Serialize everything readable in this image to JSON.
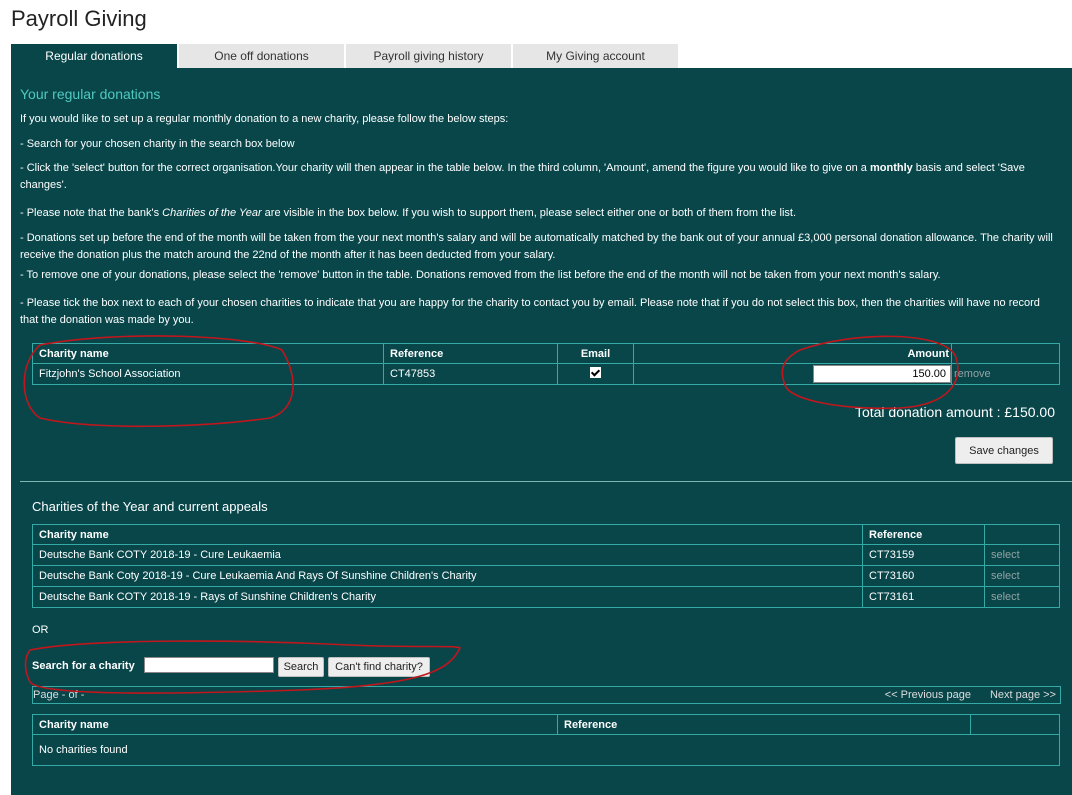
{
  "page": {
    "title": "Payroll Giving"
  },
  "tabs": [
    {
      "label": "Regular donations"
    },
    {
      "label": "One off donations"
    },
    {
      "label": "Payroll giving history"
    },
    {
      "label": "My Giving account"
    }
  ],
  "regular": {
    "heading": "Your regular donations",
    "intro": "If you would like to set up a regular monthly donation to a new charity, please follow the below steps:",
    "steps": {
      "s1": "- Search for your chosen charity in the search box below",
      "s2_pre": "- Click the 'select' button for the correct organisation.Your charity will then appear in the table below. In the third column, 'Amount', amend the figure you would like to give on a ",
      "s2_bold": "monthly",
      "s2_post": " basis and select 'Save changes'.",
      "s3_pre": "- Please note that the bank's ",
      "s3_ital": "Charities of the Year",
      "s3_post": " are visible in the box below. If you wish to support them, please select either one or both of them from the list.",
      "s4": "- Donations set up before the end of the month will be taken from the your next month's salary and will be automatically matched by the bank out of your annual £3,000 personal donation allowance. The charity will receive the donation plus the match around the 22nd of the month after it has been deducted from your salary.",
      "s5": "- To remove one of your donations, please select the 'remove' button in the table. Donations removed from the list before the end of the month will not be taken from your next month's salary.",
      "s6": "- Please tick the box next to each of your chosen charities to indicate that you are happy for the charity to contact you by email. Please note that if you do not select this box, then the charities will have no record that the donation was made by you."
    },
    "table": {
      "headers": {
        "name": "Charity name",
        "reference": "Reference",
        "email": "Email",
        "amount": "Amount"
      },
      "rows": [
        {
          "name": "Fitzjohn's School Association",
          "reference": "CT47853",
          "email_checked": true,
          "amount": "150.00",
          "action": "remove"
        }
      ]
    },
    "total": "Total donation amount : £150.00",
    "save_label": "Save changes"
  },
  "coty": {
    "heading": "Charities of the Year and current appeals",
    "headers": {
      "name": "Charity name",
      "reference": "Reference"
    },
    "rows": [
      {
        "name": "Deutsche Bank COTY 2018-19 - Cure Leukaemia",
        "reference": "CT73159",
        "action": "select"
      },
      {
        "name": "Deutsche Bank Coty 2018-19 - Cure Leukaemia And Rays Of Sunshine Children's Charity",
        "reference": "CT73160",
        "action": "select"
      },
      {
        "name": "Deutsche Bank COTY 2018-19 - Rays of Sunshine Children's Charity",
        "reference": "CT73161",
        "action": "select"
      }
    ]
  },
  "search": {
    "or_label": "OR",
    "label": "Search for a charity",
    "value": "",
    "search_button": "Search",
    "cant_find_button": "Can't find charity?",
    "pager": {
      "page_info": "Page - of -",
      "prev": "<< Previous page",
      "next": "Next page >>"
    },
    "results": {
      "headers": {
        "name": "Charity name",
        "reference": "Reference"
      },
      "empty": "No charities found"
    }
  },
  "colors": {
    "panel": "#08464a",
    "accent_heading": "#4fc9c0",
    "table_border": "#35a9a5",
    "annotation": "#c0161c"
  }
}
